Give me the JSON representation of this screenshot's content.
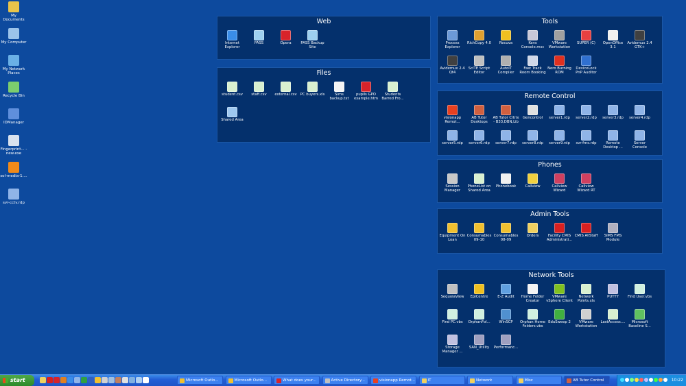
{
  "desktop_icons": [
    {
      "label": "My Documents",
      "icon": "my-documents-icon",
      "color": "#e9c44a"
    },
    {
      "label": "My Computer",
      "icon": "my-computer-icon",
      "color": "#9bc3ea"
    },
    {
      "label": "My Network Places",
      "icon": "network-places-icon",
      "color": "#6ab0e6"
    },
    {
      "label": "Recycle Bin",
      "icon": "recycle-bin-icon",
      "color": "#7ccd6e"
    },
    {
      "label": "IDManager",
      "icon": "idmanager-icon",
      "color": "#5f8fdc"
    },
    {
      "label": "Fingerprint... - new.exe",
      "icon": "app-window-icon",
      "color": "#d8e2ee"
    },
    {
      "label": "sol-media-1....",
      "icon": "vlc-icon",
      "color": "#f08a1a"
    },
    {
      "label": "svr-cctv.rdp",
      "icon": "remote-desktop-icon",
      "color": "#8fb4e8"
    }
  ],
  "panels": {
    "web": {
      "title": "Web",
      "items": [
        {
          "label": "Internet Explorer",
          "icon": "internet-explorer-icon",
          "color": "#3a8de8"
        },
        {
          "label": "PASS",
          "icon": "pass-icon",
          "color": "#9ed0f0"
        },
        {
          "label": "Opera",
          "icon": "opera-icon",
          "color": "#d8232a"
        },
        {
          "label": "PASS Backup Site",
          "icon": "pass-backup-icon",
          "color": "#9ed0f0"
        }
      ]
    },
    "files": {
      "title": "Files",
      "items": [
        {
          "label": "student.csv",
          "icon": "csv-file-icon",
          "color": "#d8f0d0"
        },
        {
          "label": "staff.csv",
          "icon": "csv-file-icon",
          "color": "#d8f0d0"
        },
        {
          "label": "external.csv",
          "icon": "csv-file-icon",
          "color": "#d8f0d0"
        },
        {
          "label": "PC buyers.xls",
          "icon": "excel-file-icon",
          "color": "#d8f0d0"
        },
        {
          "label": "Sims backup.txt",
          "icon": "text-file-icon",
          "color": "#f4f4f4"
        },
        {
          "label": "pupils GPO example.htm",
          "icon": "opera-html-icon",
          "color": "#d8232a"
        },
        {
          "label": "Students Barred Fro...",
          "icon": "excel-file-icon",
          "color": "#d8f0d0"
        },
        {
          "label": "Shared Area",
          "icon": "shared-folder-icon",
          "color": "#9ec8f0"
        }
      ]
    },
    "tools": {
      "title": "Tools",
      "items": [
        {
          "label": "Process Explorer",
          "icon": "process-explorer-icon",
          "color": "#6c9ad8"
        },
        {
          "label": "RichCopy 4.0",
          "icon": "richcopy-icon",
          "color": "#e0a030"
        },
        {
          "label": "Recuva",
          "icon": "recuva-icon",
          "color": "#f0c020"
        },
        {
          "label": "Kevs Console.msc",
          "icon": "console-icon",
          "color": "#c8c8d8"
        },
        {
          "label": "VMware Workstation",
          "icon": "vmware-icon",
          "color": "#a0a0a0"
        },
        {
          "label": "SUPER (C)",
          "icon": "super-icon",
          "color": "#e84040"
        },
        {
          "label": "OpenOffice 3.1",
          "icon": "openoffice-icon",
          "color": "#f0f0f0"
        },
        {
          "label": "Avidemux 2.4 GTK+",
          "icon": "avidemux-icon",
          "color": "#404040"
        },
        {
          "label": "Avidemux 2.4 Qt4",
          "icon": "avidemux-icon",
          "color": "#404040"
        },
        {
          "label": "SciTE Script Editor",
          "icon": "scite-icon",
          "color": "#c0c0c0"
        },
        {
          "label": "AutoIT Compiler",
          "icon": "autoit-icon",
          "color": "#b0b0b0"
        },
        {
          "label": "Fast Track Room Booking",
          "icon": "room-booking-icon",
          "color": "#d0d8e8"
        },
        {
          "label": "Nero Burning ROM",
          "icon": "nero-icon",
          "color": "#e03020"
        },
        {
          "label": "DeviceLock PnP Auditor",
          "icon": "devicelock-icon",
          "color": "#3070d0"
        }
      ]
    },
    "remote": {
      "title": "Remote Control",
      "items": [
        {
          "label": "visionapp Remot...",
          "icon": "rss-icon",
          "color": "#e84020"
        },
        {
          "label": "AB Tutor Desktops",
          "icon": "ab-tutor-icon",
          "color": "#d06040"
        },
        {
          "label": "AB Tutor Citrix - B33,DBN,Lib",
          "icon": "ab-tutor-icon",
          "color": "#d06040"
        },
        {
          "label": "Gencontrol",
          "icon": "window-icon",
          "color": "#e0e0e0"
        },
        {
          "label": "server1.rdp",
          "icon": "remote-desktop-icon",
          "color": "#8fb4e8"
        },
        {
          "label": "server2.rdp",
          "icon": "remote-desktop-icon",
          "color": "#8fb4e8"
        },
        {
          "label": "server3.rdp",
          "icon": "remote-desktop-icon",
          "color": "#8fb4e8"
        },
        {
          "label": "server4.rdp",
          "icon": "remote-desktop-icon",
          "color": "#8fb4e8"
        },
        {
          "label": "server5.rdp",
          "icon": "remote-desktop-icon",
          "color": "#8fb4e8"
        },
        {
          "label": "server6.rdp",
          "icon": "remote-desktop-icon",
          "color": "#8fb4e8"
        },
        {
          "label": "server7.rdp",
          "icon": "remote-desktop-icon",
          "color": "#8fb4e8"
        },
        {
          "label": "server8.rdp",
          "icon": "remote-desktop-icon",
          "color": "#8fb4e8"
        },
        {
          "label": "server9.rdp",
          "icon": "remote-desktop-icon",
          "color": "#8fb4e8"
        },
        {
          "label": "svr-fms.rdp",
          "icon": "remote-desktop-icon",
          "color": "#8fb4e8"
        },
        {
          "label": "Remote Desktop ...",
          "icon": "remote-desktop-icon",
          "color": "#8fb4e8"
        },
        {
          "label": "Server Console",
          "icon": "remote-desktop-icon",
          "color": "#8fb4e8"
        }
      ]
    },
    "phones": {
      "title": "Phones",
      "items": [
        {
          "label": "Session Manager",
          "icon": "session-manager-icon",
          "color": "#c8c8c8"
        },
        {
          "label": "PhoneList on Shared Area",
          "icon": "excel-file-icon",
          "color": "#d8f0d0"
        },
        {
          "label": "Phonebook",
          "icon": "phonebook-icon",
          "color": "#f0f0f0"
        },
        {
          "label": "Callview",
          "icon": "callview-icon",
          "color": "#f0d040"
        },
        {
          "label": "Callview Wizard",
          "icon": "callview-wizard-icon",
          "color": "#d04060"
        },
        {
          "label": "Callview Wizard RT",
          "icon": "callview-wizard-icon",
          "color": "#d04060"
        }
      ]
    },
    "admin": {
      "title": "Admin Tools",
      "items": [
        {
          "label": "Equipment On Loan",
          "icon": "access-db-icon",
          "color": "#f0c030"
        },
        {
          "label": "Consumables 09-10",
          "icon": "access-db-icon",
          "color": "#f0c030"
        },
        {
          "label": "Consumables 08-09",
          "icon": "access-db-icon",
          "color": "#f0c030"
        },
        {
          "label": "Orders",
          "icon": "folder-icon",
          "color": "#f0d060"
        },
        {
          "label": "Facility CMIS Administrati...",
          "icon": "facility-icon",
          "color": "#d82020"
        },
        {
          "label": "CMIS AllStaff",
          "icon": "facility-icon",
          "color": "#d82020"
        },
        {
          "label": "SIMS FMS Module",
          "icon": "sims-icon",
          "color": "#b0b0c0"
        }
      ]
    },
    "network": {
      "title": "Network Tools",
      "items": [
        {
          "label": "SequoiaView",
          "icon": "sequoiaview-icon",
          "color": "#c0c0c0"
        },
        {
          "label": "EpiCentre",
          "icon": "epicentre-icon",
          "color": "#f0c020"
        },
        {
          "label": "E-Z Audit",
          "icon": "ez-audit-icon",
          "color": "#60a0e0"
        },
        {
          "label": "Home Folder Creator",
          "icon": "text-file-icon",
          "color": "#f4f4f4"
        },
        {
          "label": "VMware vSphere Client",
          "icon": "vsphere-icon",
          "color": "#80c020"
        },
        {
          "label": "Network Points.xls",
          "icon": "excel-file-icon",
          "color": "#d8f0d0"
        },
        {
          "label": "PUTTY",
          "icon": "putty-icon",
          "color": "#c0c0e0"
        },
        {
          "label": "Find User.vbs",
          "icon": "script-file-icon",
          "color": "#d0f0e0"
        },
        {
          "label": "Find PC.vbs",
          "icon": "script-file-icon",
          "color": "#d0f0e0"
        },
        {
          "label": "OrphanFol...",
          "icon": "script-file-icon",
          "color": "#d0f0e0"
        },
        {
          "label": "WinSCP",
          "icon": "winscp-icon",
          "color": "#5090d0"
        },
        {
          "label": "Orphan Home Folders.vbs",
          "icon": "script-file-icon",
          "color": "#d0f0e0"
        },
        {
          "label": "EduSweep 2",
          "icon": "edusweep-icon",
          "color": "#40b040"
        },
        {
          "label": "VMware Workstation",
          "icon": "vmware-icon",
          "color": "#d0d0d0"
        },
        {
          "label": "LastAccess....",
          "icon": "excel-file-icon",
          "color": "#d8f0d0"
        },
        {
          "label": "Microsoft Baseline S...",
          "icon": "baseline-icon",
          "color": "#60c060"
        },
        {
          "label": "Storage Manager ...",
          "icon": "storage-icon",
          "color": "#c0c0e0"
        },
        {
          "label": "SAN_Utility",
          "icon": "san-icon",
          "color": "#a0a0c0"
        },
        {
          "label": "Performanc...",
          "icon": "performance-icon",
          "color": "#a0a0c0"
        }
      ]
    }
  },
  "taskbar": {
    "start_label": "start",
    "quick_launch": [
      {
        "icon": "ql-folder-icon",
        "color": "#f0d060"
      },
      {
        "icon": "ql-facility-icon",
        "color": "#d82020"
      },
      {
        "icon": "ql-opera-icon",
        "color": "#d8232a"
      },
      {
        "icon": "ql-firefox-icon",
        "color": "#e08020"
      },
      {
        "icon": "ql-ie-icon",
        "color": "#3a8de8"
      },
      {
        "icon": "ql-remote-icon",
        "color": "#8fb4e8"
      },
      {
        "icon": "ql-excel-icon",
        "color": "#30a040"
      },
      {
        "icon": "ql-word-icon",
        "color": "#3060c0"
      },
      {
        "icon": "ql-outlook-icon",
        "color": "#f0c030"
      },
      {
        "icon": "ql-app-icon",
        "color": "#d0d0d0"
      },
      {
        "icon": "ql-app2-icon",
        "color": "#a0c0e0"
      },
      {
        "icon": "ql-app3-icon",
        "color": "#c08060"
      },
      {
        "icon": "ql-app4-icon",
        "color": "#e0e0e0"
      },
      {
        "icon": "ql-app5-icon",
        "color": "#80b0e0"
      },
      {
        "icon": "ql-app6-icon",
        "color": "#b0d0f0"
      },
      {
        "icon": "ql-more-icon",
        "color": "#ffffff"
      }
    ],
    "buttons": [
      {
        "label": "Microsoft Outlo...",
        "icon": "outlook-task-icon",
        "color": "#f0c030"
      },
      {
        "label": "Microsoft Outlo...",
        "icon": "outlook-task-icon",
        "color": "#f0c030"
      },
      {
        "label": "What does your...",
        "icon": "opera-task-icon",
        "color": "#d8232a"
      },
      {
        "label": "Active Directory...",
        "icon": "ad-task-icon",
        "color": "#c0c0c0"
      },
      {
        "label": "visionapp Remot...",
        "icon": "visionapp-task-icon",
        "color": "#e84020"
      },
      {
        "label": "IT",
        "icon": "folder-task-icon",
        "color": "#f0d060"
      },
      {
        "label": "Network",
        "icon": "folder-task-icon",
        "color": "#f0d060"
      },
      {
        "label": "Misc",
        "icon": "folder-task-icon",
        "color": "#f0d060"
      },
      {
        "label": "AB Tutor Control",
        "icon": "ab-tutor-task-icon",
        "color": "#d06040"
      }
    ],
    "tray_icons": [
      {
        "icon": "tray-icon-1",
        "color": "#40e0ff"
      },
      {
        "icon": "tray-icon-2",
        "color": "#ffffff"
      },
      {
        "icon": "tray-icon-3",
        "color": "#80ff80"
      },
      {
        "icon": "tray-icon-4",
        "color": "#ffe040"
      },
      {
        "icon": "tray-icon-5",
        "color": "#ff6060"
      },
      {
        "icon": "tray-icon-6",
        "color": "#c0c0ff"
      },
      {
        "icon": "tray-icon-7",
        "color": "#ffffff"
      },
      {
        "icon": "tray-icon-8",
        "color": "#40ff40"
      },
      {
        "icon": "tray-icon-9",
        "color": "#ffa040"
      },
      {
        "icon": "tray-icon-10",
        "color": "#ffffff"
      }
    ],
    "clock": "10:22"
  }
}
